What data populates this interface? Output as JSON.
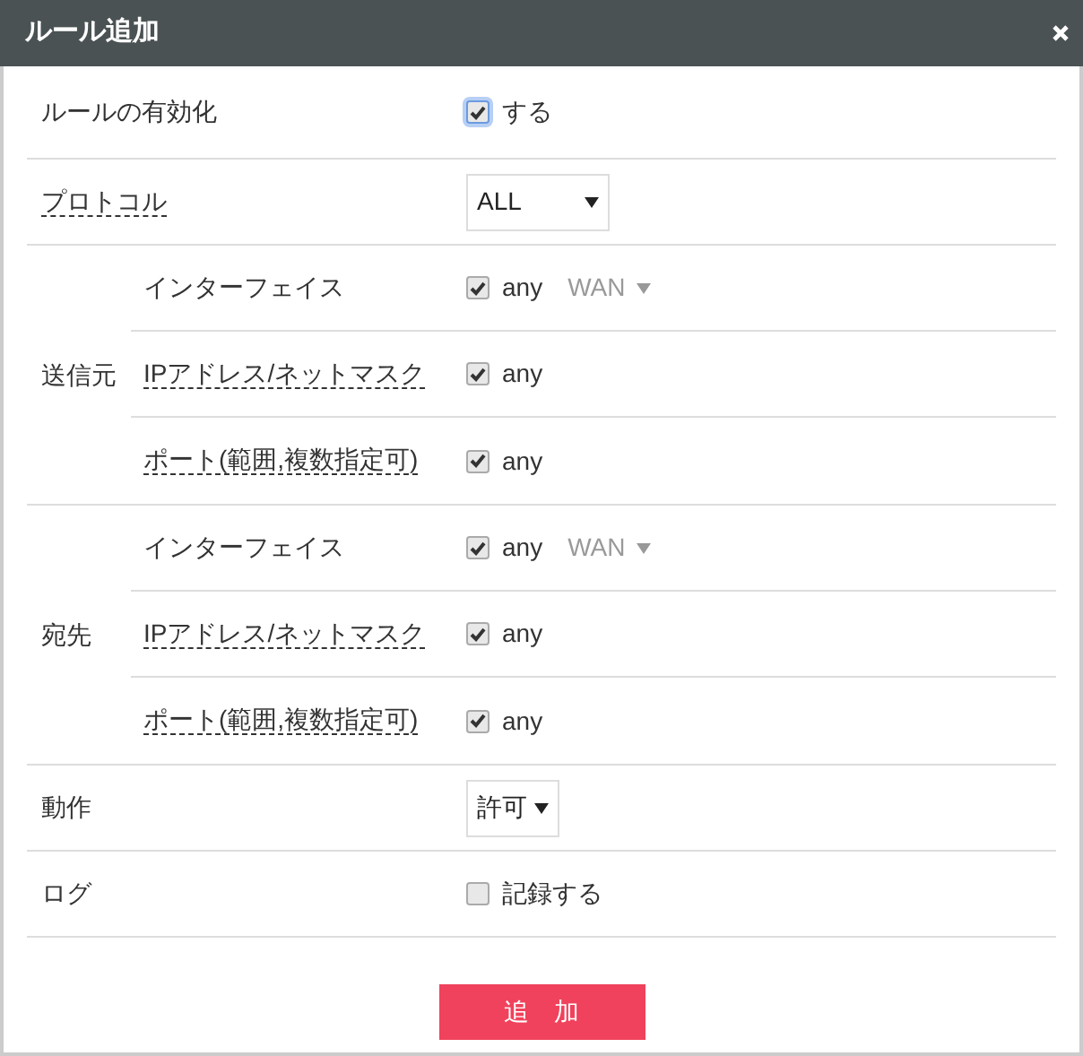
{
  "window": {
    "title": "ルール追加"
  },
  "rows": [
    {
      "kind": "checkbox",
      "label": "ルールの有効化",
      "has_help": false,
      "checked": true,
      "focused": true,
      "text": "する"
    },
    {
      "kind": "select",
      "label": "プロトコル",
      "has_help": true,
      "value": "ALL"
    },
    {
      "kind": "group",
      "label": "送信元",
      "children": [
        {
          "label": "インターフェイス",
          "has_help": false,
          "checked": true,
          "text": "any",
          "select": {
            "value": "WAN",
            "disabled": true
          }
        },
        {
          "label": "IPアドレス/ネットマスク",
          "has_help": true,
          "checked": true,
          "text": "any"
        },
        {
          "label": "ポート(範囲,複数指定可)",
          "has_help": true,
          "checked": true,
          "text": "any"
        }
      ]
    },
    {
      "kind": "group",
      "label": "宛先",
      "children": [
        {
          "label": "インターフェイス",
          "has_help": false,
          "checked": true,
          "text": "any",
          "select": {
            "value": "WAN",
            "disabled": true
          }
        },
        {
          "label": "IPアドレス/ネットマスク",
          "has_help": true,
          "checked": true,
          "text": "any"
        },
        {
          "label": "ポート(範囲,複数指定可)",
          "has_help": true,
          "checked": true,
          "text": "any"
        }
      ]
    },
    {
      "kind": "select",
      "label": "動作",
      "has_help": false,
      "value": "許可"
    },
    {
      "kind": "checkbox",
      "label": "ログ",
      "has_help": false,
      "checked": false,
      "focused": false,
      "text": "記録する"
    }
  ],
  "submit": "追　加"
}
